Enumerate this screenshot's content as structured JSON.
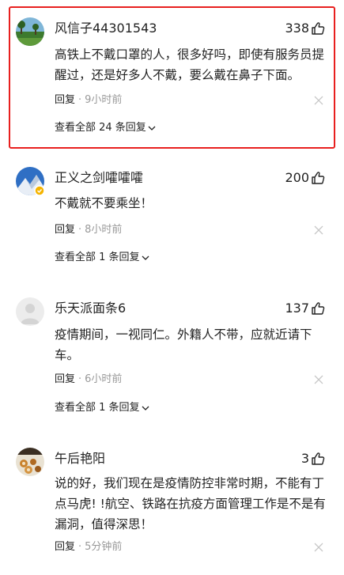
{
  "comments": [
    {
      "username": "风信子44301543",
      "likes": "338",
      "text": "高铁上不戴口罩的人，很多好吗，即使有服务员提醒过，还是好多人不戴，要么戴在鼻子下面。",
      "reply_label": "回复",
      "separator": "·",
      "time": "9小时前",
      "replies_label": "查看全部 24 条回复",
      "avatar_icon": "landscape-avatar",
      "highlighted": true
    },
    {
      "username": "正义之剑嚯嚯嚯",
      "likes": "200",
      "text": "不戴就不要乘坐！",
      "reply_label": "回复",
      "separator": "·",
      "time": "8小时前",
      "replies_label": "查看全部 1 条回复",
      "avatar_icon": "mountain-verified-avatar"
    },
    {
      "username": "乐天派面条6",
      "likes": "137",
      "text": "疫情期间，一视同仁。外籍人不带，应就近请下车。",
      "reply_label": "回复",
      "separator": "·",
      "time": "6小时前",
      "replies_label": "查看全部 1 条回复",
      "avatar_icon": "default-person-avatar"
    },
    {
      "username": "午后艳阳",
      "likes": "3",
      "text": "说的好，我们现在是疫情防控非常时期，不能有丁点马虎! !航空、铁路在抗疫方面管理工作是不是有漏洞，值得深思！",
      "reply_label": "回复",
      "separator": "·",
      "time": "5分钟前",
      "avatar_icon": "food-photo-avatar"
    }
  ],
  "colors": {
    "highlight_border": "#e8201f",
    "muted": "#999999",
    "text": "#222222"
  }
}
